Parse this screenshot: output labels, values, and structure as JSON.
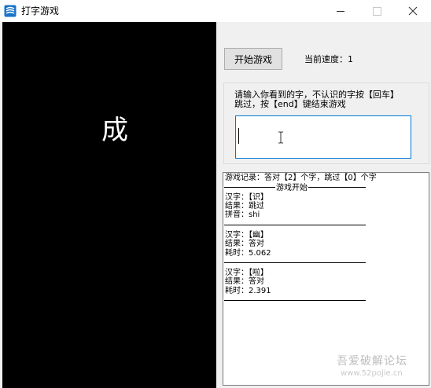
{
  "window": {
    "title": "打字游戏",
    "app_icon": "app-icon",
    "controls": {
      "minimize": "minimize-icon",
      "maximize": "maximize-icon",
      "close": "close-icon"
    }
  },
  "display": {
    "character": "成"
  },
  "controls": {
    "start_button": "开始游戏",
    "speed_text": "当前速度：1"
  },
  "input": {
    "prompt_line1": "请输入你看到的字，不认识的字按【回车】",
    "prompt_line2": "跳过，按【end】键结束游戏",
    "value": ""
  },
  "log": {
    "summary": "游戏记录：答对【2】个字，跳过【0】个字",
    "start_text": "游戏开始",
    "entries": [
      {
        "char": "汉字：【识】",
        "result": "结果：跳过",
        "extra": "拼音：shi"
      },
      {
        "char": "汉字：【幽】",
        "result": "结果：答对",
        "extra": "耗时：5.062"
      },
      {
        "char": "汉字：【啦】",
        "result": "结果：答对",
        "extra": "耗时：2.391"
      }
    ]
  },
  "watermark": {
    "text": "吾爱破解论坛",
    "url": "www.52pojie.cn"
  },
  "colors": {
    "input_border": "#0078d7",
    "display_bg": "#000000",
    "window_bg": "#f0f0f0"
  }
}
